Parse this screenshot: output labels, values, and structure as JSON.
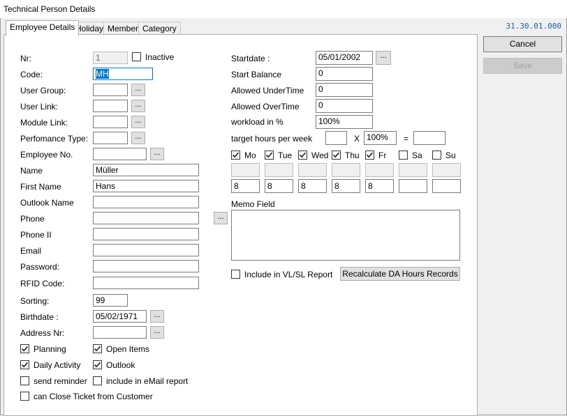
{
  "window": {
    "title": "Technical Person Details",
    "version": "31.30.01.000"
  },
  "tabs": [
    {
      "label": "Employee Details"
    },
    {
      "label": "Holiday"
    },
    {
      "label": "Member"
    },
    {
      "label": "Category"
    }
  ],
  "buttons": {
    "cancel": "Cancel",
    "save": "Save",
    "dots": "...",
    "recalculate": "Recalculate DA Hours Records"
  },
  "left": {
    "nr": {
      "label": "Nr:",
      "value": "1"
    },
    "inactive": {
      "label": "Inactive",
      "checked": false
    },
    "code": {
      "label": "Code:",
      "value": "MH"
    },
    "user_group": {
      "label": "User Group:",
      "value": ""
    },
    "user_link": {
      "label": "User Link:",
      "value": ""
    },
    "module_link": {
      "label": "Module Link:",
      "value": ""
    },
    "performance_type": {
      "label": "Perfomance Type:",
      "value": ""
    },
    "employee_no": {
      "label": "Employee No.",
      "value": ""
    },
    "name": {
      "label": "Name",
      "value": "Müller"
    },
    "first_name": {
      "label": "First Name",
      "value": "Hans"
    },
    "outlook_name": {
      "label": "Outlook Name",
      "value": ""
    },
    "phone": {
      "label": "Phone",
      "value": ""
    },
    "phone2": {
      "label": "Phone II",
      "value": ""
    },
    "email": {
      "label": "Email",
      "value": ""
    },
    "password": {
      "label": "Password:",
      "value": ""
    },
    "rfid": {
      "label": "RFID Code:",
      "value": ""
    },
    "sorting": {
      "label": "Sorting:",
      "value": "99"
    },
    "birthdate": {
      "label": "Birthdate :",
      "value": "05/02/1971"
    },
    "address_nr": {
      "label": "Address Nr:",
      "value": ""
    }
  },
  "checkboxes": {
    "planning": {
      "label": "Planning",
      "checked": true
    },
    "open_items": {
      "label": "Open Items",
      "checked": true
    },
    "daily_activity": {
      "label": "Daily Activity",
      "checked": true
    },
    "outlook": {
      "label": "Outlook",
      "checked": true
    },
    "send_reminder": {
      "label": "send reminder",
      "checked": false
    },
    "include_email": {
      "label": "include in eMail report",
      "checked": false
    },
    "close_ticket": {
      "label": "can Close Ticket from Customer",
      "checked": false
    },
    "include_vlsl": {
      "label": "Include in VL/SL Report",
      "checked": false
    }
  },
  "right": {
    "startdate": {
      "label": "Startdate :",
      "value": "05/01/2002"
    },
    "start_balance": {
      "label": "Start Balance",
      "value": "0"
    },
    "allowed_undertime": {
      "label": "Allowed UnderTime",
      "value": "0"
    },
    "allowed_overtime": {
      "label": "Allowed OverTime",
      "value": "0"
    },
    "workload": {
      "label": "workload in %",
      "value": "100%"
    },
    "target_hours": {
      "label": "target hours per week",
      "value": "",
      "times": "X",
      "percent": "100%",
      "equals": "=",
      "result": ""
    },
    "memo_label": "Memo Field"
  },
  "days": [
    {
      "label": "Mo",
      "checked": true,
      "hours": "8"
    },
    {
      "label": "Tue",
      "checked": true,
      "hours": "8"
    },
    {
      "label": "Wed",
      "checked": true,
      "hours": "8"
    },
    {
      "label": "Thu",
      "checked": true,
      "hours": "8"
    },
    {
      "label": "Fr",
      "checked": true,
      "hours": "8"
    },
    {
      "label": "Sa",
      "checked": false,
      "hours": ""
    },
    {
      "label": "Su",
      "checked": false,
      "hours": ""
    }
  ]
}
